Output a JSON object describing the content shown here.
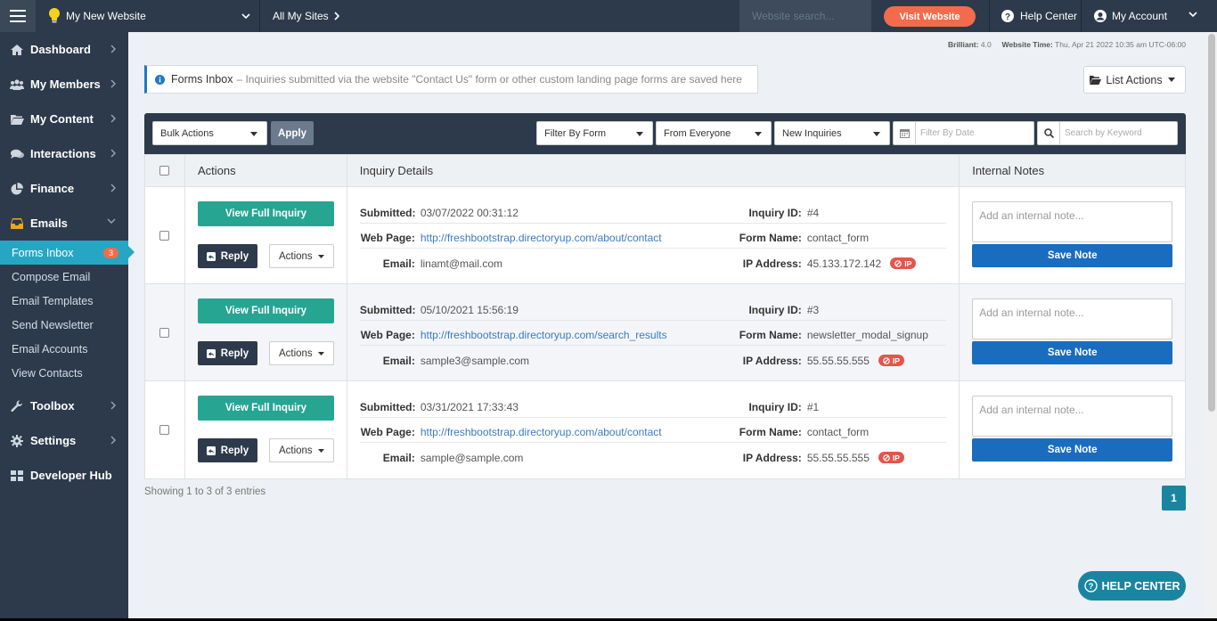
{
  "topbar": {
    "site_name": "My New Website",
    "all_sites": "All My Sites",
    "search_placeholder": "Website search...",
    "visit_label": "Visit Website",
    "help_label": "Help Center",
    "account_label": "My Account"
  },
  "sidebar": {
    "items": [
      {
        "label": "Dashboard",
        "icon": "dashboard-icon"
      },
      {
        "label": "My Members",
        "icon": "members-icon"
      },
      {
        "label": "My Content",
        "icon": "folder-icon"
      },
      {
        "label": "Interactions",
        "icon": "chat-icon"
      },
      {
        "label": "Finance",
        "icon": "pie-chart-icon"
      },
      {
        "label": "Emails",
        "icon": "inbox-icon"
      }
    ],
    "emails_sub": [
      {
        "label": "Forms Inbox",
        "badge": "3"
      },
      {
        "label": "Compose Email"
      },
      {
        "label": "Email Templates"
      },
      {
        "label": "Send Newsletter"
      },
      {
        "label": "Email Accounts"
      },
      {
        "label": "View Contacts"
      }
    ],
    "bottom_items": [
      {
        "label": "Toolbox",
        "icon": "wrench-icon"
      },
      {
        "label": "Settings",
        "icon": "gear-icon"
      },
      {
        "label": "Developer Hub",
        "icon": "grid-icon"
      }
    ]
  },
  "meta": {
    "brilliant_label": "Brilliant:",
    "brilliant_value": "4.0",
    "time_label": "Website Time:",
    "time_value": "Thu, Apr 21 2022 10:35 am UTC-06:00"
  },
  "info": {
    "title": "Forms Inbox",
    "text": "– Inquiries submitted via the website \"Contact Us\" form or other custom landing page forms are saved here"
  },
  "list_actions_label": "List Actions",
  "filters": {
    "bulk": "Bulk Actions",
    "apply": "Apply",
    "form": "Filter By Form",
    "from": "From Everyone",
    "status": "New Inquiries",
    "date_placeholder": "Filter By Date",
    "keyword_placeholder": "Search by Keyword"
  },
  "table": {
    "headers": {
      "actions": "Actions",
      "details": "Inquiry Details",
      "notes": "Internal Notes"
    },
    "labels": {
      "view": "View Full Inquiry",
      "reply": "Reply",
      "actions": "Actions",
      "submitted": "Submitted:",
      "webpage": "Web Page:",
      "email": "Email:",
      "inquiry_id": "Inquiry ID:",
      "form_name": "Form Name:",
      "ip": "IP Address:",
      "ip_badge": "IP",
      "note_placeholder": "Add an internal note...",
      "save": "Save Note"
    },
    "rows": [
      {
        "submitted": "03/07/2022 00:31:12",
        "webpage": "http://freshbootstrap.directoryup.com/about/contact",
        "email": "linamt@mail.com",
        "id": "#4",
        "form": "contact_form",
        "ip": "45.133.172.142"
      },
      {
        "submitted": "05/10/2021 15:56:19",
        "webpage": "http://freshbootstrap.directoryup.com/search_results",
        "email": "sample3@sample.com",
        "id": "#3",
        "form": "newsletter_modal_signup",
        "ip": "55.55.55.555"
      },
      {
        "submitted": "03/31/2021 17:33:43",
        "webpage": "http://freshbootstrap.directoryup.com/about/contact",
        "email": "sample@sample.com",
        "id": "#1",
        "form": "contact_form",
        "ip": "55.55.55.555"
      }
    ]
  },
  "footer": {
    "showing": "Showing 1 to 3 of 3 entries",
    "page": "1",
    "help_fab": "HELP CENTER"
  },
  "colors": {
    "nav_bg": "#2c3a4b",
    "accent": "#27a6c4",
    "visit": "#f26b4c",
    "teal_button": "#26a592",
    "save_button": "#1a6cbf"
  }
}
